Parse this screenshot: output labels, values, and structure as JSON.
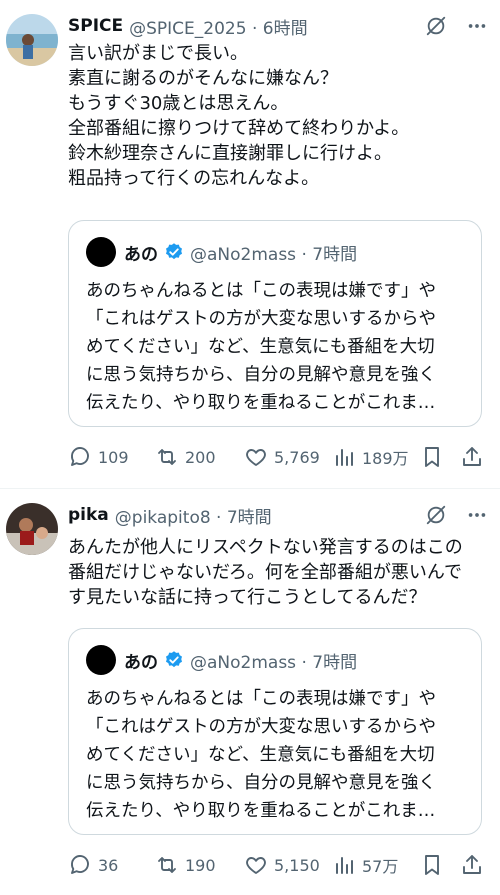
{
  "posts": [
    {
      "display_name": "SPICE",
      "handle_time": "@SPICE_2025 · 6時間",
      "text": "言い訳がまじで長い。\n素直に謝るのがそんなに嫌なん？\nもうすぐ30歳とは思えん。\n全部番組に擦りつけて辞めて終わりかよ。\n鈴木紗理奈さんに直接謝罪しに行けよ。\n粗品持って行くの忘れんなよ。",
      "quote": {
        "display_name": "あの",
        "handle_time": "@aNo2mass · 7時間",
        "text": "あのちゃんねるとは「この表現は嫌です」や\n「これはゲストの方が大変な思いするからや\nめてください」など、生意気にも番組を大切\nに思う気持ちから、自分の見解や意見を強く\n伝えたり、やり取りを重ねることがこれま…"
      },
      "replies": "109",
      "reposts": "200",
      "likes": "5,769",
      "views": "189万"
    },
    {
      "display_name": "pika",
      "handle_time": "@pikapito8 · 7時間",
      "text": "あんたが他人にリスペクトない発言するのはこの\n番組だけじゃないだろ。何を全部番組が悪いんで\nす見たいな話に持って行こうとしてるんだ？",
      "quote": {
        "display_name": "あの",
        "handle_time": "@aNo2mass · 7時間",
        "text": "あのちゃんねるとは「この表現は嫌です」や\n「これはゲストの方が大変な思いするからや\nめてください」など、生意気にも番組を大切\nに思う気持ちから、自分の見解や意見を強く\n伝えたり、やり取りを重ねることがこれま…"
      },
      "replies": "36",
      "reposts": "190",
      "likes": "5,150",
      "views": "57万"
    }
  ],
  "icons": {
    "reply": "reply-icon",
    "repost": "repost-icon",
    "like": "like-icon",
    "views": "views-icon",
    "bookmark": "bookmark-icon",
    "share": "share-icon",
    "grok": "grok-icon",
    "more": "more-icon",
    "verified": "verified-badge-icon"
  },
  "colors": {
    "text": "#0f1419",
    "secondary": "#536471",
    "verified": "#1d9bf0",
    "border": "#cfd9de"
  }
}
